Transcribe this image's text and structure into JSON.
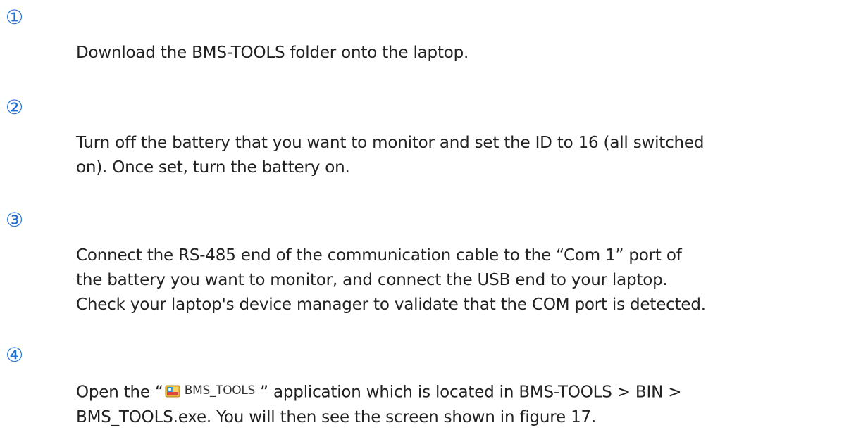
{
  "colors": {
    "step_number": "#1f6fd1",
    "body_text": "#222222",
    "background": "#ffffff"
  },
  "steps": [
    {
      "number": "①",
      "lines": [
        "Download the BMS-TOOLS folder onto the laptop."
      ]
    },
    {
      "number": "②",
      "lines": [
        "Turn off the battery that you want to monitor and set the ID to 16 (all switched",
        "on). Once set, turn the battery on."
      ]
    },
    {
      "number": "③",
      "lines": [
        "Connect the RS-485 end of the communication cable to the “Com 1” port of",
        "the battery you want to monitor, and connect the USB end to your laptop.",
        "Check your laptop's device manager to validate that the COM port is detected."
      ]
    },
    {
      "number": "④",
      "line1_before": "Open the “",
      "app_icon": "bms-tools-app-icon",
      "app_name": "BMS_TOOLS",
      "line1_after": " ” application which is located in BMS-TOOLS > BIN >",
      "line2": "BMS_TOOLS.exe. You will then see the screen shown in figure 17."
    }
  ]
}
